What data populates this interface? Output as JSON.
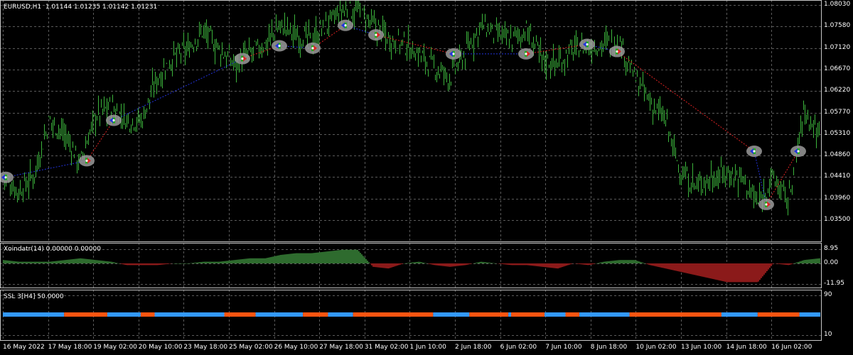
{
  "main_chart": {
    "title": "EURUSD,H1  1.01144 1.01235 1.01142 1.01231",
    "y_ticks": [
      "1.08030",
      "1.07580",
      "1.07120",
      "1.06670",
      "1.06220",
      "1.05770",
      "1.05310",
      "1.04860",
      "1.04410",
      "1.03960",
      "1.03500"
    ],
    "colors": {
      "bars": "#3cb43c",
      "grid": "#5a5a5a",
      "buy_line": "#2233dd",
      "sell_line": "#dd2222",
      "marker_bg": "#9a9a9a"
    }
  },
  "indicator1": {
    "title": "Xoindatr(14) 0.00000 0.00000",
    "y_ticks": [
      "8.95",
      "0.00",
      "-11.95"
    ],
    "colors": {
      "positive": "#2e6b2e",
      "negative": "#8b1a1a"
    }
  },
  "indicator2": {
    "title": "SSL 3[H4] 50.0000",
    "y_ticks": [
      "90",
      "10"
    ],
    "colors": {
      "up": "#3399ff",
      "down": "#ff5511"
    }
  },
  "x_ticks": [
    "16 May 2022",
    "17 May 18:00",
    "19 May 02:00",
    "20 May 10:00",
    "23 May 18:00",
    "25 May 02:00",
    "26 May 10:00",
    "27 May 18:00",
    "31 May 02:00",
    "1 Jun 10:00",
    "2 Jun 18:00",
    "6 Jun 02:00",
    "7 Jun 10:00",
    "8 Jun 18:00",
    "10 Jun 02:00",
    "13 Jun 10:00",
    "14 Jun 18:00",
    "16 Jun 02:00"
  ],
  "chart_data": {
    "type": "line",
    "symbol": "EURUSD",
    "timeframe": "H1",
    "ohlc_last": {
      "open": 1.01144,
      "high": 1.01235,
      "low": 1.01142,
      "close": 1.01231
    },
    "ylim": [
      1.035,
      1.0803
    ],
    "x_dates": [
      "16 May 2022",
      "17 May 18:00",
      "19 May 02:00",
      "20 May 10:00",
      "23 May 18:00",
      "25 May 02:00",
      "26 May 10:00",
      "27 May 18:00",
      "31 May 02:00",
      "1 Jun 10:00",
      "2 Jun 18:00",
      "6 Jun 02:00",
      "7 Jun 10:00",
      "8 Jun 18:00",
      "10 Jun 02:00",
      "13 Jun 10:00",
      "14 Jun 18:00",
      "16 Jun 02:00"
    ],
    "price": [
      1.044,
      1.041,
      1.0445,
      1.056,
      1.053,
      1.047,
      1.057,
      1.059,
      1.056,
      1.056,
      1.065,
      1.069,
      1.071,
      1.075,
      1.071,
      1.068,
      1.07,
      1.072,
      1.076,
      1.074,
      1.073,
      1.076,
      1.079,
      1.079,
      1.076,
      1.0735,
      1.072,
      1.07,
      1.067,
      1.065,
      1.07,
      1.076,
      1.074,
      1.073,
      1.075,
      1.069,
      1.068,
      1.071,
      1.0715,
      1.072,
      1.073,
      1.065,
      1.06,
      1.056,
      1.045,
      1.042,
      1.044,
      1.045,
      1.044,
      1.0385,
      1.044,
      1.039,
      1.058,
      1.053
    ],
    "signals": [
      {
        "type": "buy",
        "price": 1.044
      },
      {
        "type": "sell",
        "price": 1.0475
      },
      {
        "type": "buy",
        "price": 1.056
      },
      {
        "type": "sell",
        "price": 1.069
      },
      {
        "type": "buy",
        "price": 1.0717
      },
      {
        "type": "sell",
        "price": 1.0712
      },
      {
        "type": "buy",
        "price": 1.076
      },
      {
        "type": "sell",
        "price": 1.074
      },
      {
        "type": "buy",
        "price": 1.07
      },
      {
        "type": "sell",
        "price": 1.07
      },
      {
        "type": "buy",
        "price": 1.072
      },
      {
        "type": "sell",
        "price": 1.0705
      },
      {
        "type": "buy",
        "price": 1.0495
      },
      {
        "type": "sell",
        "price": 1.0383
      },
      {
        "type": "buy",
        "price": 1.0495
      }
    ],
    "indicator1_values": [
      2,
      1,
      1,
      1,
      2,
      3,
      2,
      1,
      -1,
      -1,
      -1,
      0,
      0,
      1,
      1,
      2,
      3,
      3,
      5,
      6,
      6,
      7,
      8,
      8,
      -2,
      -3,
      0,
      1,
      -1,
      -2,
      -1,
      1,
      0,
      -1,
      -1,
      -2,
      -3,
      0,
      -1,
      1,
      2,
      2,
      -1,
      -3,
      -5,
      -7,
      -9,
      -11,
      -11,
      -11,
      0,
      -1,
      2,
      3
    ],
    "indicator2_segments": [
      "up",
      "down",
      "up",
      "down",
      "up",
      "down",
      "up",
      "down",
      "up",
      "down",
      "up",
      "down",
      "up",
      "down",
      "up",
      "down",
      "up",
      "down",
      "up",
      "down",
      "up",
      "down",
      "up",
      "down",
      "up",
      "down",
      "up"
    ],
    "indicator2_weights": [
      88,
      62,
      48,
      20,
      100,
      45,
      68,
      36,
      36,
      115,
      52,
      56,
      4,
      48,
      30,
      20,
      72,
      132,
      52,
      60,
      30
    ]
  }
}
